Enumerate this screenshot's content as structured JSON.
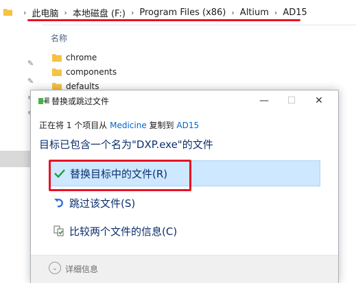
{
  "address_bar": {
    "crumbs": [
      "此电脑",
      "本地磁盘 (F:)",
      "Program Files (x86)",
      "Altium",
      "AD15"
    ],
    "separator": "›"
  },
  "explorer": {
    "column_header": "名称",
    "files": [
      "chrome",
      "components",
      "defaults"
    ]
  },
  "dialog": {
    "title": "替换或跳过文件",
    "source_prefix": "正在将 1 个项目从",
    "source_name": "Medicine",
    "source_middle": "复制到",
    "dest_name": "AD15",
    "headline": "目标已包含一个名为\"DXP.exe\"的文件",
    "options": [
      {
        "label": "替换目标中的文件(R)",
        "icon": "check-icon",
        "selected": true
      },
      {
        "label": "跳过该文件(S)",
        "icon": "skip-icon",
        "selected": false
      },
      {
        "label": "比较两个文件的信息(C)",
        "icon": "compare-icon",
        "selected": false
      }
    ],
    "details_label": "详细信息",
    "window_buttons": {
      "minimize": "—",
      "maximize": "☐",
      "close": "✕"
    }
  },
  "colors": {
    "highlight": "#e81123",
    "link": "#0066cc",
    "selection": "#cde8ff"
  }
}
